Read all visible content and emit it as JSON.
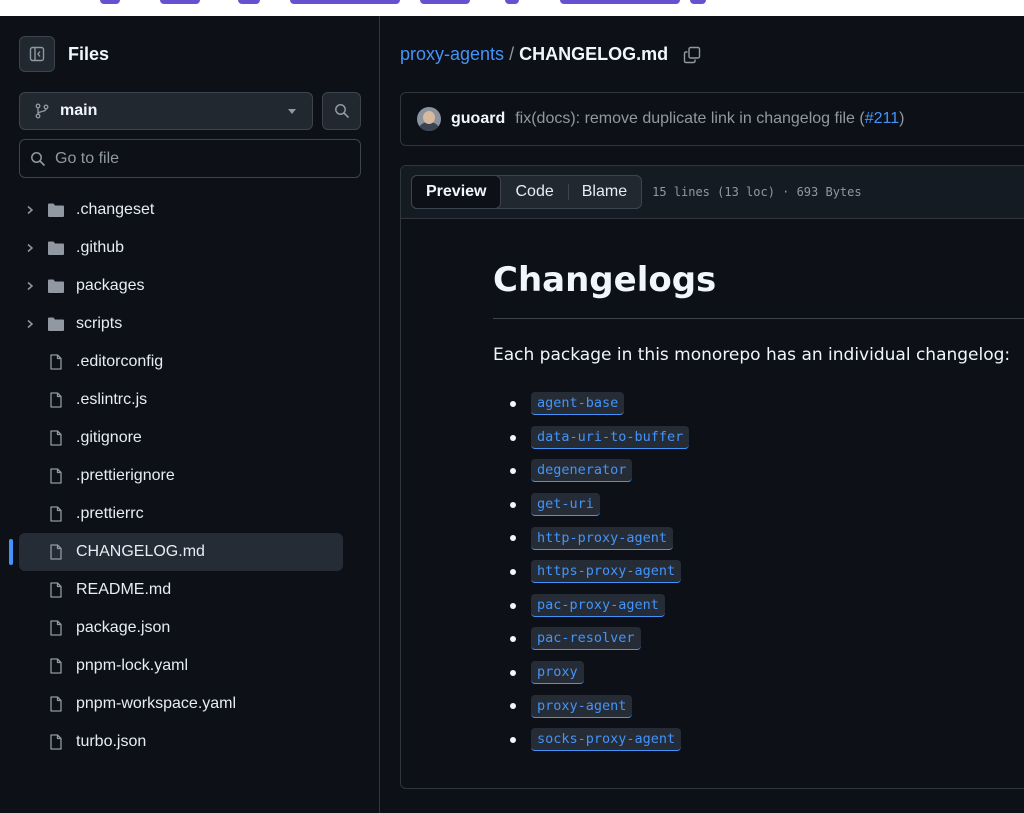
{
  "sidebar": {
    "title": "Files",
    "branch": "main",
    "goto_placeholder": "Go to file",
    "items": [
      {
        "label": ".changeset",
        "type": "dir"
      },
      {
        "label": ".github",
        "type": "dir"
      },
      {
        "label": "packages",
        "type": "dir"
      },
      {
        "label": "scripts",
        "type": "dir"
      },
      {
        "label": ".editorconfig",
        "type": "file"
      },
      {
        "label": ".eslintrc.js",
        "type": "file"
      },
      {
        "label": ".gitignore",
        "type": "file"
      },
      {
        "label": ".prettierignore",
        "type": "file"
      },
      {
        "label": ".prettierrc",
        "type": "file"
      },
      {
        "label": "CHANGELOG.md",
        "type": "file",
        "active": true
      },
      {
        "label": "README.md",
        "type": "file"
      },
      {
        "label": "package.json",
        "type": "file"
      },
      {
        "label": "pnpm-lock.yaml",
        "type": "file"
      },
      {
        "label": "pnpm-workspace.yaml",
        "type": "file"
      },
      {
        "label": "turbo.json",
        "type": "file"
      }
    ]
  },
  "breadcrumb": {
    "repo": "proxy-agents",
    "separator": "/",
    "file": "CHANGELOG.md"
  },
  "commit": {
    "author": "guoard",
    "message": "fix(docs): remove duplicate link in changelog file (",
    "pr": "#211",
    "message_end": ")"
  },
  "viewer": {
    "tabs": [
      "Preview",
      "Code",
      "Blame"
    ],
    "selected_tab": "Preview",
    "info": "15 lines (13 loc) · 693 Bytes"
  },
  "content": {
    "heading": "Changelogs",
    "intro": "Each package in this monorepo has an individual changelog:",
    "packages": [
      "agent-base",
      "data-uri-to-buffer",
      "degenerator",
      "get-uri",
      "http-proxy-agent",
      "https-proxy-agent",
      "pac-proxy-agent",
      "pac-resolver",
      "proxy",
      "proxy-agent",
      "socks-proxy-agent"
    ]
  },
  "colors": {
    "background": "#0d1117",
    "link": "#4493f8",
    "border": "#30363d",
    "active_indicator": "#4493f8"
  },
  "icons": {
    "sidebar_toggle": "sidebar-collapse-icon",
    "branch": "git-branch-icon",
    "search": "search-icon",
    "folder": "folder-icon",
    "file": "file-icon",
    "chevron": "chevron-right-icon",
    "copy": "copy-icon"
  }
}
